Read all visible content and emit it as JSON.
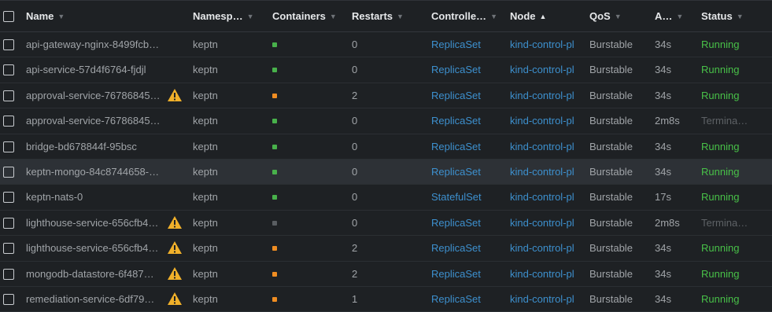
{
  "colors": {
    "running": "#48c048",
    "terminating": "#5e6266",
    "link": "#3d90ce",
    "container_ok": "#48b14b",
    "container_warn": "#ef8d22",
    "container_off": "#5a5e62",
    "warning_icon": "#f0b02a"
  },
  "columns": [
    {
      "key": "name",
      "label": "Name",
      "sort": "none"
    },
    {
      "key": "namespace",
      "label": "Namesp…",
      "sort": "none"
    },
    {
      "key": "containers",
      "label": "Containers",
      "sort": "none"
    },
    {
      "key": "restarts",
      "label": "Restarts",
      "sort": "none"
    },
    {
      "key": "controller",
      "label": "Controlle…",
      "sort": "none"
    },
    {
      "key": "node",
      "label": "Node",
      "sort": "asc"
    },
    {
      "key": "qos",
      "label": "QoS",
      "sort": "none"
    },
    {
      "key": "age",
      "label": "A…",
      "sort": "none"
    },
    {
      "key": "status",
      "label": "Status",
      "sort": "none"
    }
  ],
  "rows": [
    {
      "name": "api-gateway-nginx-8499fcb…",
      "warning": false,
      "namespace": "keptn",
      "container": "ok",
      "restarts": "0",
      "controller": "ReplicaSet",
      "node": "kind-control-pl",
      "qos": "Burstable",
      "age": "34s",
      "status": "Running",
      "status_kind": "running"
    },
    {
      "name": "api-service-57d4f6764-fjdjl",
      "warning": false,
      "namespace": "keptn",
      "container": "ok",
      "restarts": "0",
      "controller": "ReplicaSet",
      "node": "kind-control-pl",
      "qos": "Burstable",
      "age": "34s",
      "status": "Running",
      "status_kind": "running"
    },
    {
      "name": "approval-service-76786845…",
      "warning": true,
      "namespace": "keptn",
      "container": "warn",
      "restarts": "2",
      "controller": "ReplicaSet",
      "node": "kind-control-pl",
      "qos": "Burstable",
      "age": "34s",
      "status": "Running",
      "status_kind": "running"
    },
    {
      "name": "approval-service-76786845…",
      "warning": false,
      "namespace": "keptn",
      "container": "ok",
      "restarts": "0",
      "controller": "ReplicaSet",
      "node": "kind-control-pl",
      "qos": "Burstable",
      "age": "2m8s",
      "status": "Termina…",
      "status_kind": "term"
    },
    {
      "name": "bridge-bd678844f-95bsc",
      "warning": false,
      "namespace": "keptn",
      "container": "ok",
      "restarts": "0",
      "controller": "ReplicaSet",
      "node": "kind-control-pl",
      "qos": "Burstable",
      "age": "34s",
      "status": "Running",
      "status_kind": "running"
    },
    {
      "name": "keptn-mongo-84c8744658-…",
      "warning": false,
      "namespace": "keptn",
      "container": "ok",
      "restarts": "0",
      "controller": "ReplicaSet",
      "node": "kind-control-pl",
      "qos": "Burstable",
      "age": "34s",
      "status": "Running",
      "status_kind": "running",
      "highlight": true
    },
    {
      "name": "keptn-nats-0",
      "warning": false,
      "namespace": "keptn",
      "container": "ok",
      "restarts": "0",
      "controller": "StatefulSet",
      "node": "kind-control-pl",
      "qos": "Burstable",
      "age": "17s",
      "status": "Running",
      "status_kind": "running"
    },
    {
      "name": "lighthouse-service-656cfb4…",
      "warning": true,
      "namespace": "keptn",
      "container": "off",
      "restarts": "0",
      "controller": "ReplicaSet",
      "node": "kind-control-pl",
      "qos": "Burstable",
      "age": "2m8s",
      "status": "Termina…",
      "status_kind": "term"
    },
    {
      "name": "lighthouse-service-656cfb4…",
      "warning": true,
      "namespace": "keptn",
      "container": "warn",
      "restarts": "2",
      "controller": "ReplicaSet",
      "node": "kind-control-pl",
      "qos": "Burstable",
      "age": "34s",
      "status": "Running",
      "status_kind": "running"
    },
    {
      "name": "mongodb-datastore-6f487…",
      "warning": true,
      "namespace": "keptn",
      "container": "warn",
      "restarts": "2",
      "controller": "ReplicaSet",
      "node": "kind-control-pl",
      "qos": "Burstable",
      "age": "34s",
      "status": "Running",
      "status_kind": "running"
    },
    {
      "name": "remediation-service-6df79…",
      "warning": true,
      "namespace": "keptn",
      "container": "warn",
      "restarts": "1",
      "controller": "ReplicaSet",
      "node": "kind-control-pl",
      "qos": "Burstable",
      "age": "34s",
      "status": "Running",
      "status_kind": "running"
    }
  ]
}
